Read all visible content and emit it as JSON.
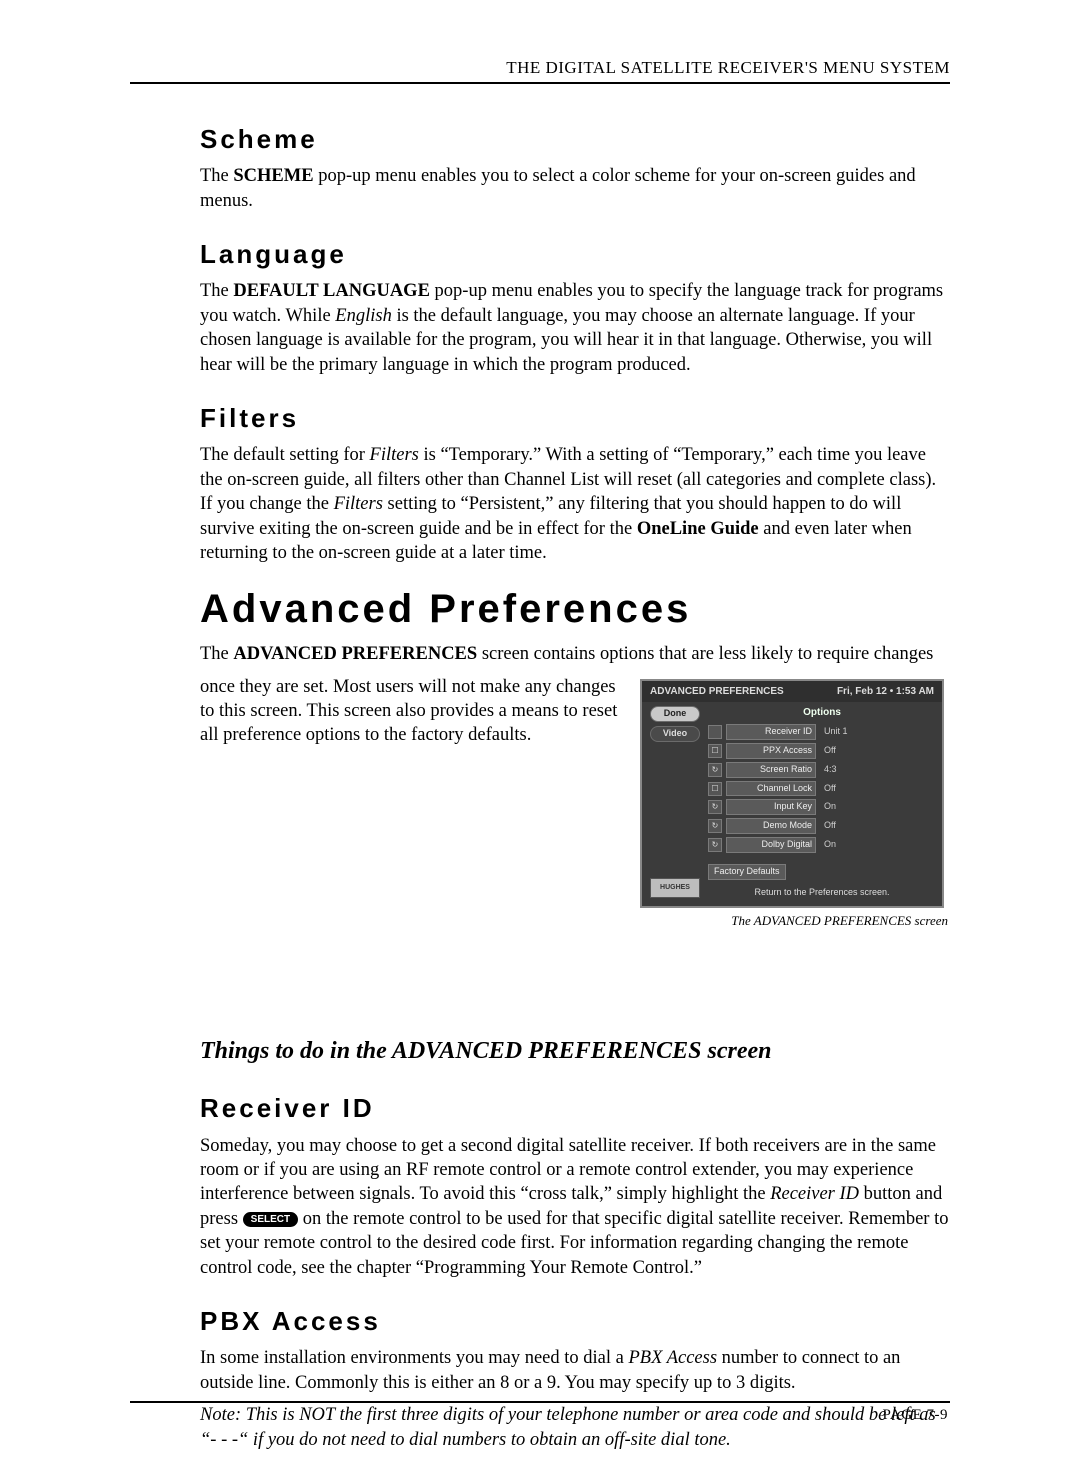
{
  "running_head": "THE DIGITAL SATELLITE RECEIVER'S MENU SYSTEM",
  "page_number_label": "PAGE 7-9",
  "scheme": {
    "heading": "Scheme",
    "p1_a": "The ",
    "p1_bold": "SCHEME",
    "p1_b": " pop-up menu enables you to select a color scheme for your on-screen guides and menus."
  },
  "language": {
    "heading": "Language",
    "p1_a": "The ",
    "p1_bold": "DEFAULT LANGUAGE",
    "p1_b": " pop-up menu enables you to specify the language track for programs you watch. While ",
    "p1_it": "English",
    "p1_c": " is the default language, you may choose an alternate language. If your chosen language is available for the program, you will hear it in that language. Otherwise, you will hear will be the primary language in which the program produced."
  },
  "filters": {
    "heading": "Filters",
    "p1_a": "The default setting for ",
    "p1_it1": "Filters",
    "p1_b": " is “Temporary.” With a setting of “Temporary,” each time you leave the on-screen guide, all filters other than Channel List will reset (all categories and complete class). If you change the ",
    "p1_it2": "Filters",
    "p1_c": " setting to “Persistent,” any filtering that you should happen to do will survive exiting the on-screen guide and be in effect for the ",
    "p1_bold": "OneLine Guide",
    "p1_d": " and even later when returning to the on-screen guide at a later time."
  },
  "advpref": {
    "heading": "Advanced Preferences",
    "intro_a": "The ",
    "intro_bold": "ADVANCED PREFERENCES",
    "intro_b": " screen contains options that are less likely to require changes",
    "intro_c": "once they are set. Most users will not make any changes to this screen. This screen also provides a means to reset all preference options to the factory defaults.",
    "caption": "The ADVANCED PREFERENCES screen",
    "shot": {
      "title": "ADVANCED PREFERENCES",
      "time": "Fri, Feb 12 • 1:53 AM",
      "done": "Done",
      "video": "Video",
      "logo": "HUGHES",
      "options_label": "Options",
      "rows": [
        {
          "icon": "",
          "label": "Receiver ID",
          "value": "Unit 1"
        },
        {
          "icon": "☐",
          "label": "PPX Access",
          "value": "Off"
        },
        {
          "icon": "↻",
          "label": "Screen Ratio",
          "value": "4:3"
        },
        {
          "icon": "☐",
          "label": "Channel Lock",
          "value": "Off"
        },
        {
          "icon": "↻",
          "label": "Input Key",
          "value": "On"
        },
        {
          "icon": "↻",
          "label": "Demo Mode",
          "value": "Off"
        },
        {
          "icon": "↻",
          "label": "Dolby Digital",
          "value": "On"
        }
      ],
      "factory": "Factory Defaults",
      "hint": "Return to the Preferences screen."
    }
  },
  "things": {
    "heading": "Things to do in the ADVANCED PREFERENCES screen"
  },
  "receiver_id": {
    "heading": "Receiver ID",
    "p1_a": "Someday, you may choose to get a second digital satellite receiver. If both receivers are in the same room or if you are using an RF remote control or a remote control extender, you may experience interference between signals. To avoid this “cross talk,” simply highlight the ",
    "p1_it": "Receiver ID",
    "p1_b": " button and press ",
    "select_btn": "SELECT",
    "p1_c": " on the remote control to be used for that specific digital satellite receiver. Remember to set your remote control to the desired code first. For information regarding changing the remote control code, see the chapter “Programming Your Remote Control.”"
  },
  "pbx": {
    "heading": "PBX Access",
    "p1_a": "In some installation environments you may need to dial a ",
    "p1_it": "PBX Access",
    "p1_b": " number to connect to an outside line.  Commonly this is either an 8 or a 9.  You may specify up to 3 digits.",
    "note": "Note: This is NOT the first three digits of your telephone number or area code and should be left as “- - -“ if you do not need to dial numbers to obtain an off-site dial tone."
  }
}
